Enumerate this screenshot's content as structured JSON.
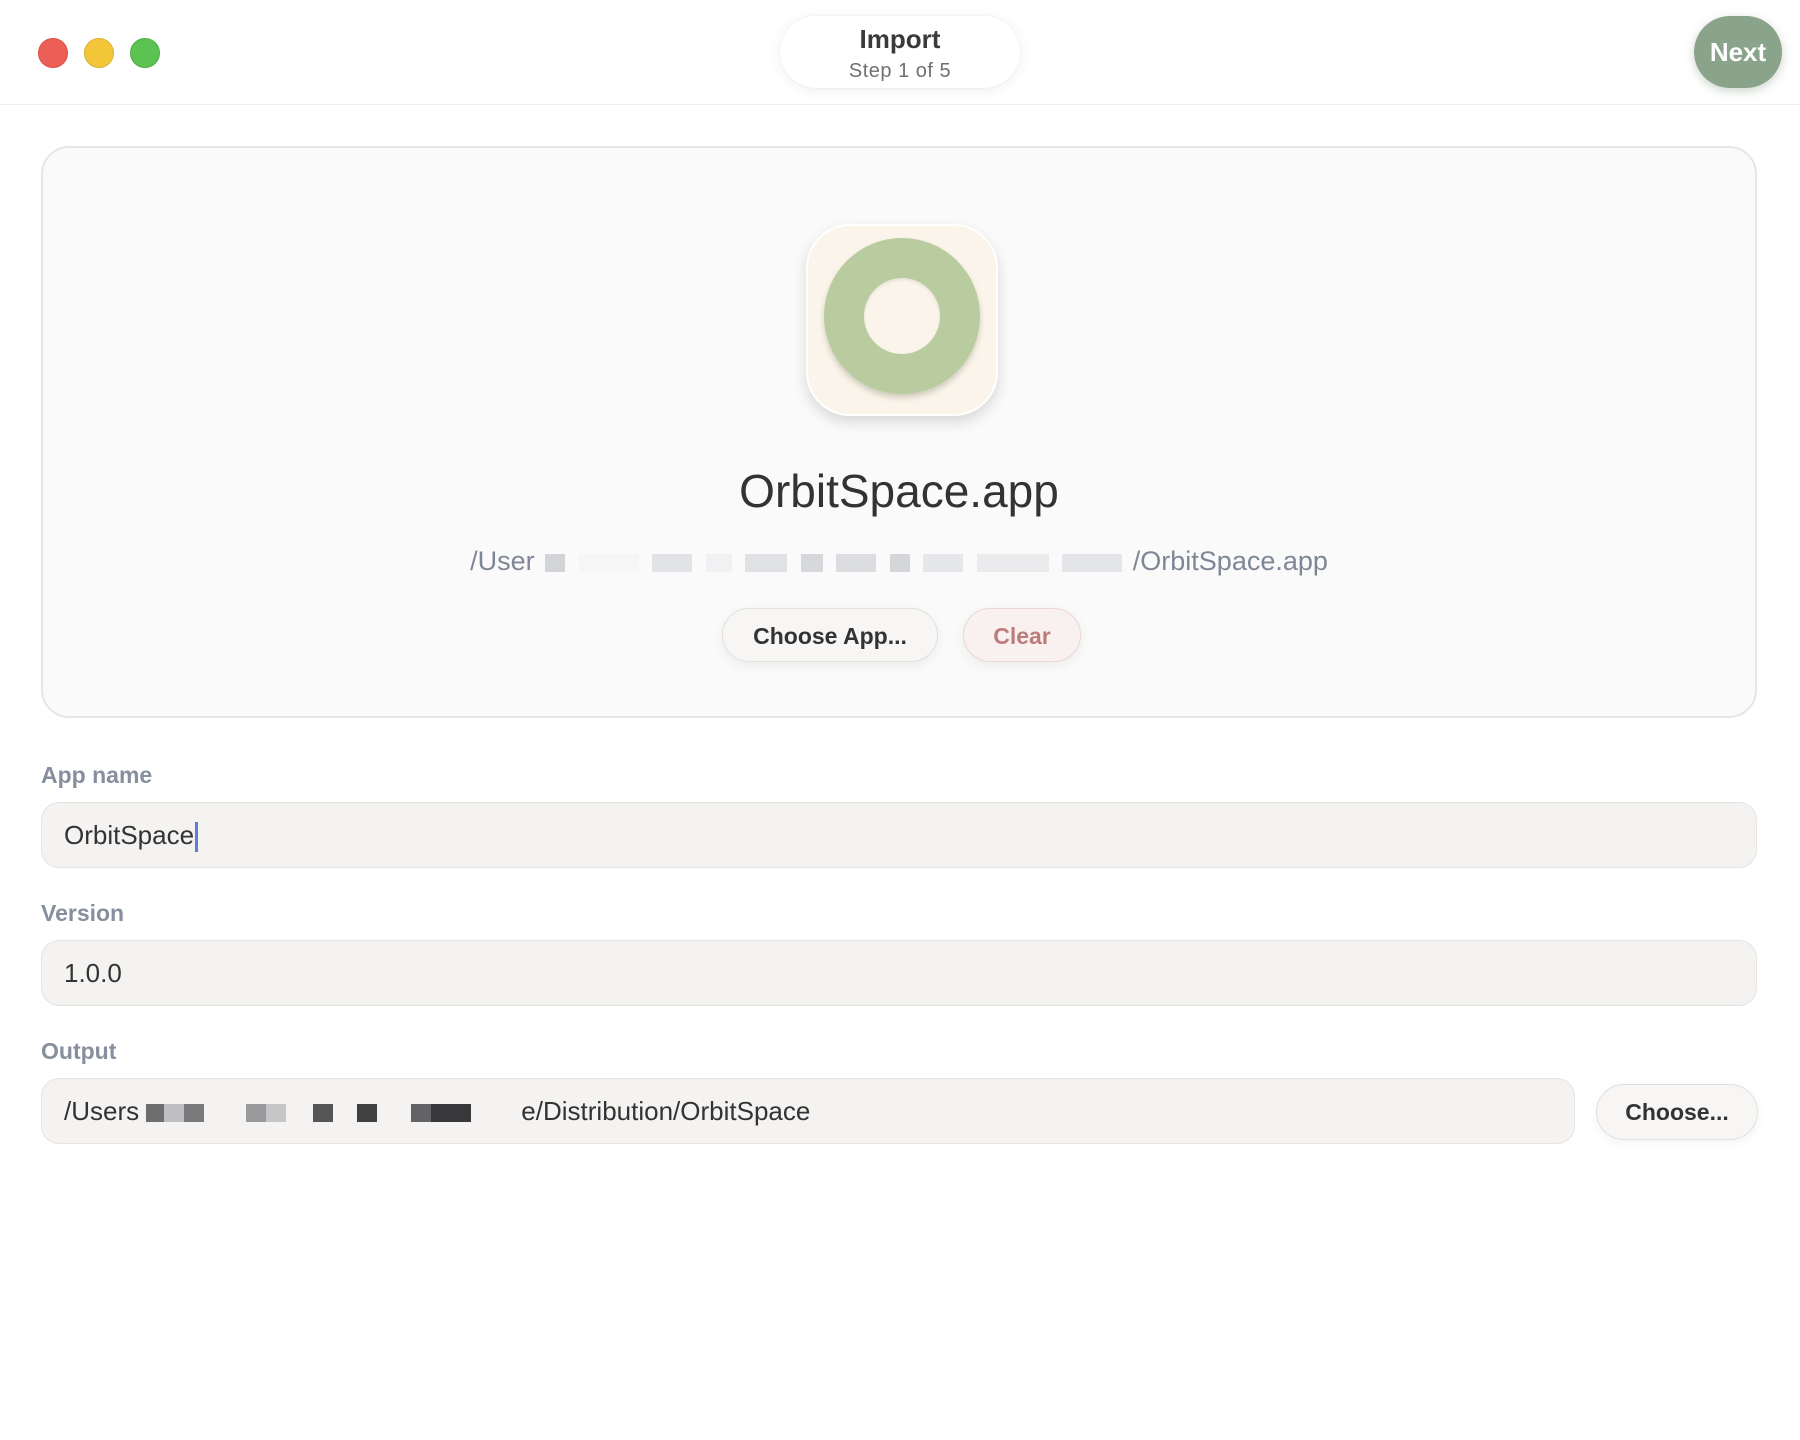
{
  "window": {
    "traffic_lights": [
      "close",
      "minimize",
      "zoom"
    ]
  },
  "header": {
    "title": "Import",
    "step": "Step 1 of 5",
    "next_label": "Next"
  },
  "app_card": {
    "icon": "orbit-ring-icon",
    "file_name": "OrbitSpace.app",
    "path_prefix": "/User",
    "path_suffix": "/OrbitSpace.app",
    "choose_label": "Choose App...",
    "clear_label": "Clear"
  },
  "form": {
    "app_name": {
      "label": "App name",
      "value": "OrbitSpace"
    },
    "version": {
      "label": "Version",
      "value": "1.0.0"
    },
    "output": {
      "label": "Output",
      "value_prefix": "/Users",
      "value_suffix": "e/Distribution/OrbitSpace",
      "choose_label": "Choose..."
    }
  },
  "colors": {
    "accent": "#8aa38b",
    "destructive": "#bd7b7b",
    "icon_ring": "#b9cc9f"
  }
}
